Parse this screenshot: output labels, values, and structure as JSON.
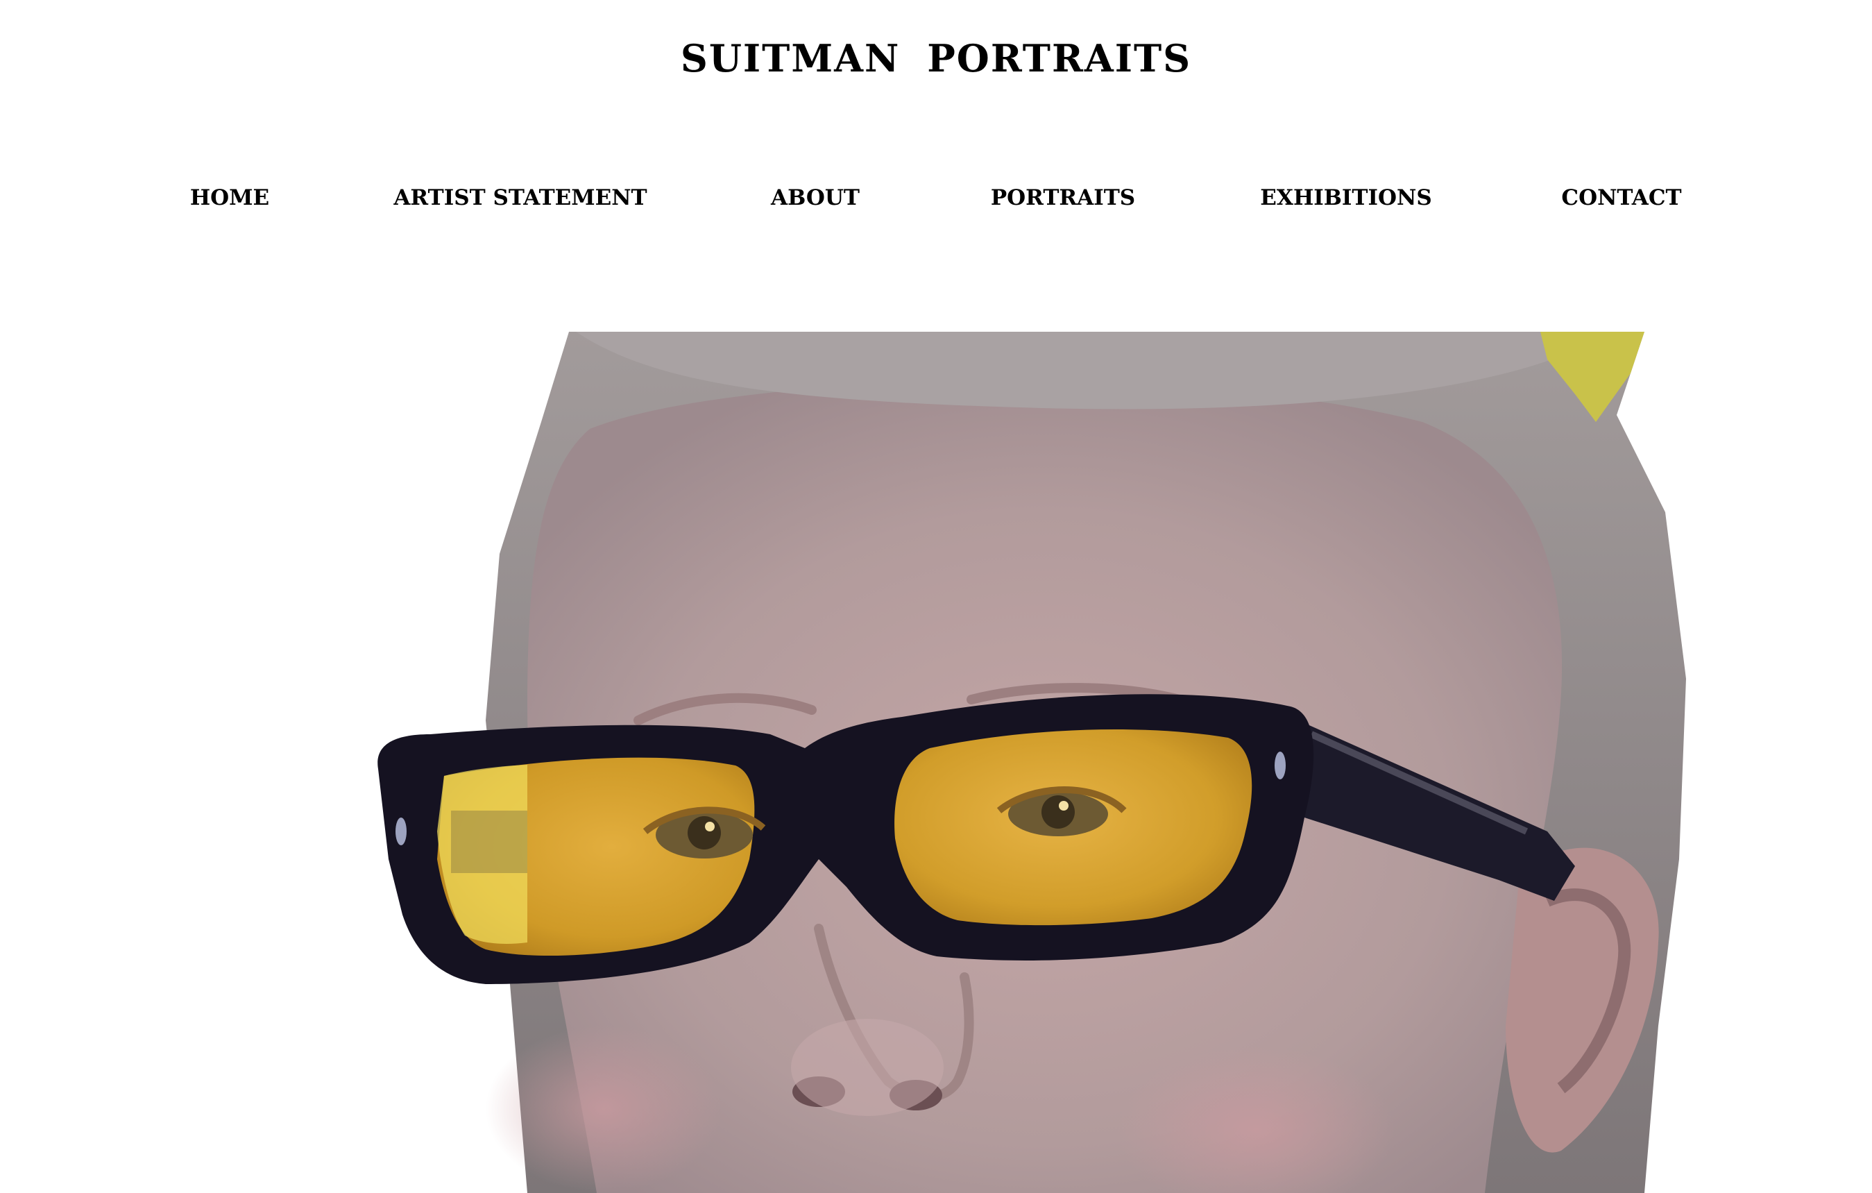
{
  "site": {
    "title": "SUITMAN   PORTRAITS"
  },
  "nav": {
    "items": [
      {
        "label": "HOME"
      },
      {
        "label": "ARTIST STATEMENT"
      },
      {
        "label": "ABOUT"
      },
      {
        "label": "PORTRAITS"
      },
      {
        "label": "EXHIBITIONS"
      },
      {
        "label": "CONTACT"
      }
    ]
  },
  "hero": {
    "subject": "child-portrait-yellow-glasses"
  },
  "colors": {
    "background": "#ffffff",
    "text": "#000000",
    "lens": "#d9a32a",
    "frame": "#151221",
    "skin": "#b9a2a2",
    "hair": "#8c8787"
  }
}
